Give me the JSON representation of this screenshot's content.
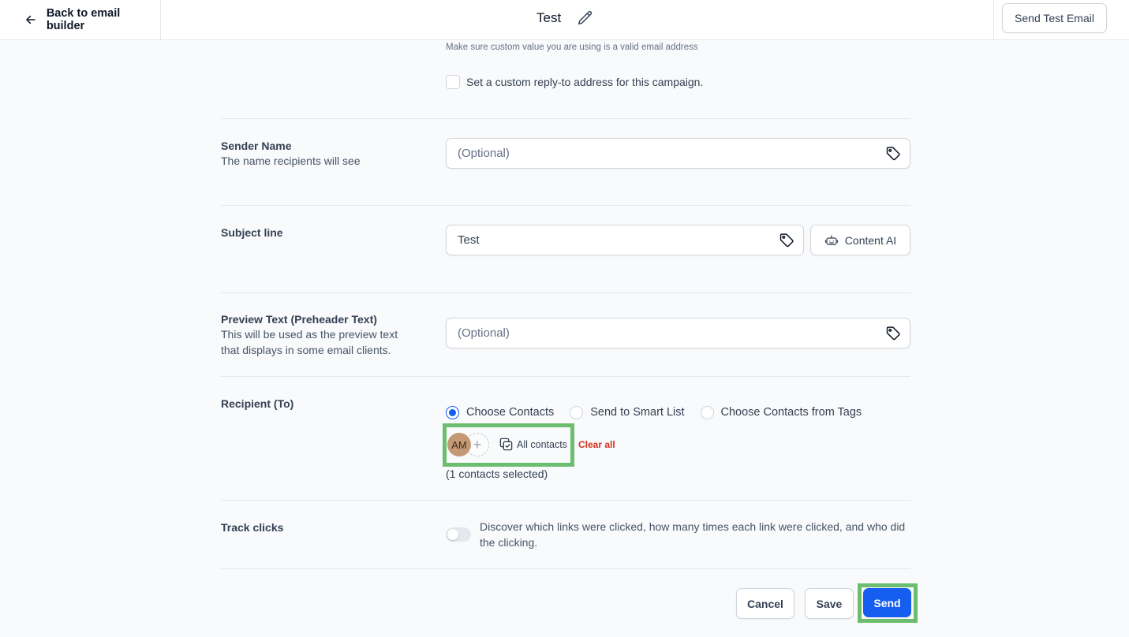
{
  "header": {
    "back_label": "Back to email builder",
    "title": "Test",
    "send_test_label": "Send Test Email"
  },
  "reply_to": {
    "hint": "Make sure custom value you are using is a valid email address",
    "checkbox_label": "Set a custom reply-to address for this campaign."
  },
  "sender_name": {
    "label": "Sender Name",
    "description": "The name recipients will see",
    "placeholder": "(Optional)"
  },
  "subject_line": {
    "label": "Subject line",
    "value": "Test",
    "content_ai_label": "Content AI"
  },
  "preview_text": {
    "label": "Preview Text (Preheader Text)",
    "description": "This will be used as the preview text that displays in some email clients.",
    "placeholder": "(Optional)"
  },
  "recipient": {
    "label": "Recipient (To)",
    "options": [
      {
        "label": "Choose Contacts",
        "selected": true
      },
      {
        "label": "Send to Smart List",
        "selected": false
      },
      {
        "label": "Choose Contacts from Tags",
        "selected": false
      }
    ],
    "avatar_initials": "AM",
    "all_contacts_label": "All contacts",
    "clear_all_label": "Clear all",
    "count_text": "(1 contacts selected)"
  },
  "track_clicks": {
    "label": "Track clicks",
    "enabled": false,
    "description": "Discover which links were clicked, how many times each link were clicked, and who did the clicking."
  },
  "actions": {
    "cancel_label": "Cancel",
    "save_label": "Save",
    "send_label": "Send"
  },
  "colors": {
    "primary": "#155eef",
    "danger": "#d92d20",
    "highlight": "#6dbd70",
    "avatar": "#c49a76"
  }
}
